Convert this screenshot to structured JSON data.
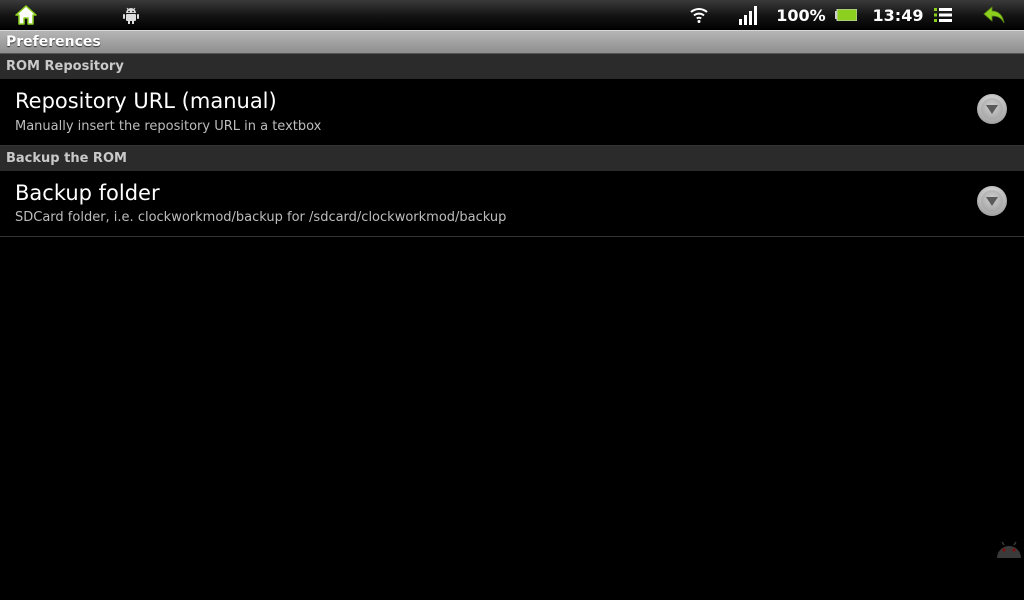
{
  "status_bar": {
    "battery_percent": "100%",
    "time": "13:49",
    "accent_color": "#8ccf1e",
    "icons": {
      "home": "home-icon",
      "android": "android-debug-icon",
      "wifi": "wifi-icon",
      "signal": "signal-bars-icon",
      "battery": "battery-icon",
      "menu": "menu-list-icon",
      "back": "back-arrow-icon"
    }
  },
  "title_bar": {
    "title": "Preferences"
  },
  "sections": [
    {
      "header": "ROM Repository",
      "items": [
        {
          "title": "Repository URL (manual)",
          "summary": "Manually insert the repository URL in a textbox"
        }
      ]
    },
    {
      "header": "Backup the ROM",
      "items": [
        {
          "title": "Backup folder",
          "summary": "SDCard folder, i.e. clockworkmod/backup for /sdcard/clockworkmod/backup"
        }
      ]
    }
  ]
}
